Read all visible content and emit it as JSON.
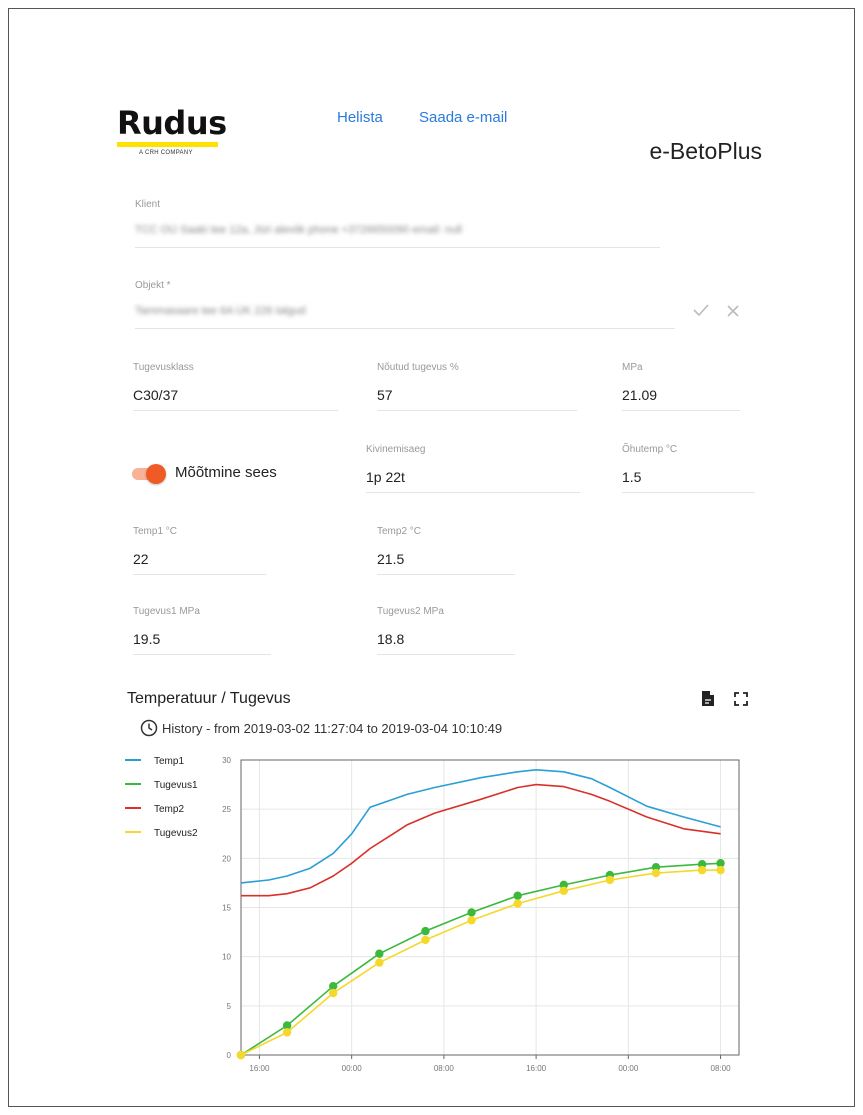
{
  "header": {
    "logo": {
      "word": "Rudus",
      "tagline": "A CRH COMPANY"
    },
    "links": {
      "call": "Helista",
      "email": "Saada e-mail"
    },
    "app_title": "e-BetoPlus"
  },
  "form": {
    "client": {
      "label": "Klient",
      "value": "TCC OÜ Saaki tee 12a, Jüri aleviik phone +3726650090 email: null"
    },
    "object": {
      "label": "Objekt *",
      "value": "Tammasaare tee 6A ÜK 226 talgud"
    },
    "strength_class": {
      "label": "Tugevusklass",
      "value": "C30/37"
    },
    "required_strength": {
      "label": "Nõutud tugevus %",
      "value": "57"
    },
    "mpa": {
      "label": "MPa",
      "value": "21.09"
    },
    "measure_toggle": {
      "label": "Mõõtmine sees",
      "on": true
    },
    "curing_time": {
      "label": "Kivinemisaeg",
      "value": "1p 22t"
    },
    "air_temp": {
      "label": "Õhutemp °C",
      "value": "1.5"
    },
    "temp1": {
      "label": "Temp1 °C",
      "value": "22"
    },
    "temp2": {
      "label": "Temp2 °C",
      "value": "21.5"
    },
    "strength1": {
      "label": "Tugevus1 MPa",
      "value": "19.5"
    },
    "strength2": {
      "label": "Tugevus2 MPa",
      "value": "18.8"
    }
  },
  "chart_section": {
    "title": "Temperatuur / Tugevus",
    "history": "History - from 2019-03-02 11:27:04 to 2019-03-04 10:10:49",
    "icons": [
      "file-icon",
      "fullscreen-icon"
    ]
  },
  "chart_data": {
    "type": "line",
    "x": [
      12,
      17,
      22,
      27,
      32,
      37,
      42,
      47,
      52,
      57,
      62,
      63
    ],
    "x_ticks": [
      {
        "at": 14,
        "label": "16:00"
      },
      {
        "at": 24,
        "label": "00:00"
      },
      {
        "at": 34,
        "label": "08:00"
      },
      {
        "at": 44,
        "label": "16:00"
      },
      {
        "at": 54,
        "label": "00:00"
      },
      {
        "at": 64,
        "label": "08:00"
      }
    ],
    "xlim": [
      12,
      66
    ],
    "ylim": [
      0,
      30
    ],
    "y_ticks": [
      0,
      5,
      10,
      15,
      20,
      25,
      30
    ],
    "grid": true,
    "legend_position": "left",
    "series": [
      {
        "name": "Temp1",
        "color": "#2a9fd6",
        "markers": false,
        "x": [
          12,
          15,
          17,
          19.5,
          22,
          24,
          26,
          28.5,
          30,
          33,
          38,
          42,
          44,
          47,
          50,
          52,
          56,
          60,
          64
        ],
        "values": [
          17.5,
          17.8,
          18.2,
          19.0,
          20.5,
          22.5,
          25.2,
          26.0,
          26.5,
          27.2,
          28.2,
          28.8,
          29.0,
          28.8,
          28.1,
          27.2,
          25.3,
          24.2,
          23.2
        ]
      },
      {
        "name": "Tugevus1",
        "color": "#3cb93c",
        "markers": true,
        "x": [
          12,
          17,
          22,
          27,
          32,
          37,
          42,
          47,
          52,
          57,
          62,
          64
        ],
        "values": [
          0,
          3.0,
          7.0,
          10.3,
          12.6,
          14.5,
          16.2,
          17.3,
          18.3,
          19.1,
          19.4,
          19.5
        ]
      },
      {
        "name": "Temp2",
        "color": "#d9302a",
        "markers": false,
        "x": [
          12,
          15,
          17,
          19.5,
          22,
          24,
          26,
          28.5,
          30,
          33,
          38,
          42,
          44,
          47,
          50,
          52,
          56,
          60,
          64
        ],
        "values": [
          16.2,
          16.2,
          16.4,
          17.0,
          18.2,
          19.5,
          21.0,
          22.5,
          23.4,
          24.6,
          26.0,
          27.2,
          27.5,
          27.3,
          26.5,
          25.8,
          24.2,
          23.0,
          22.5
        ]
      },
      {
        "name": "Tugevus2",
        "color": "#f5d82a",
        "markers": true,
        "x": [
          12,
          17,
          22,
          27,
          32,
          37,
          42,
          47,
          52,
          57,
          62,
          64
        ],
        "values": [
          0,
          2.3,
          6.3,
          9.4,
          11.7,
          13.7,
          15.4,
          16.7,
          17.8,
          18.5,
          18.8,
          18.8
        ]
      }
    ]
  }
}
